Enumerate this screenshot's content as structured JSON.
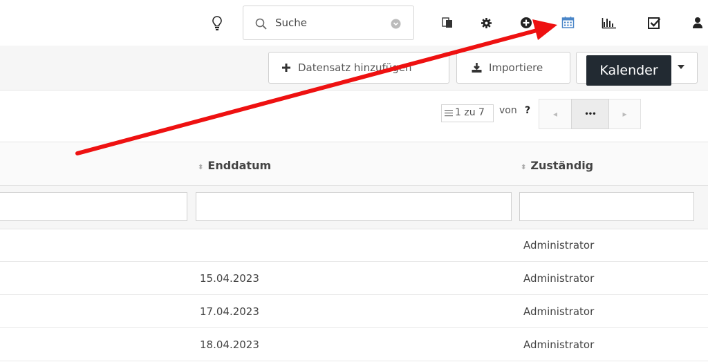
{
  "topbar": {
    "search_placeholder": "Suche",
    "icons": [
      "lightbulb-icon",
      "translate-icon",
      "gear-icon",
      "plus-circle-icon",
      "calendar-icon",
      "bar-chart-icon",
      "checkbox-icon",
      "user-icon"
    ]
  },
  "actions": {
    "add_label": "Datensatz hinzufügen",
    "import_label": "Importiere",
    "tooltip": "Kalender"
  },
  "pager": {
    "range": "1 zu 7",
    "of_label": "von",
    "total": "?",
    "more_label": "•••"
  },
  "grid": {
    "columns": [
      "Enddatum",
      "Zuständig"
    ],
    "rows": [
      {
        "enddatum": "",
        "zustaendig": "Administrator"
      },
      {
        "enddatum": "15.04.2023",
        "zustaendig": "Administrator"
      },
      {
        "enddatum": "17.04.2023",
        "zustaendig": "Administrator"
      },
      {
        "enddatum": "18.04.2023",
        "zustaendig": "Administrator"
      }
    ]
  },
  "colors": {
    "annotation_arrow": "#ee1111",
    "calendar_icon": "#4a86c8"
  }
}
